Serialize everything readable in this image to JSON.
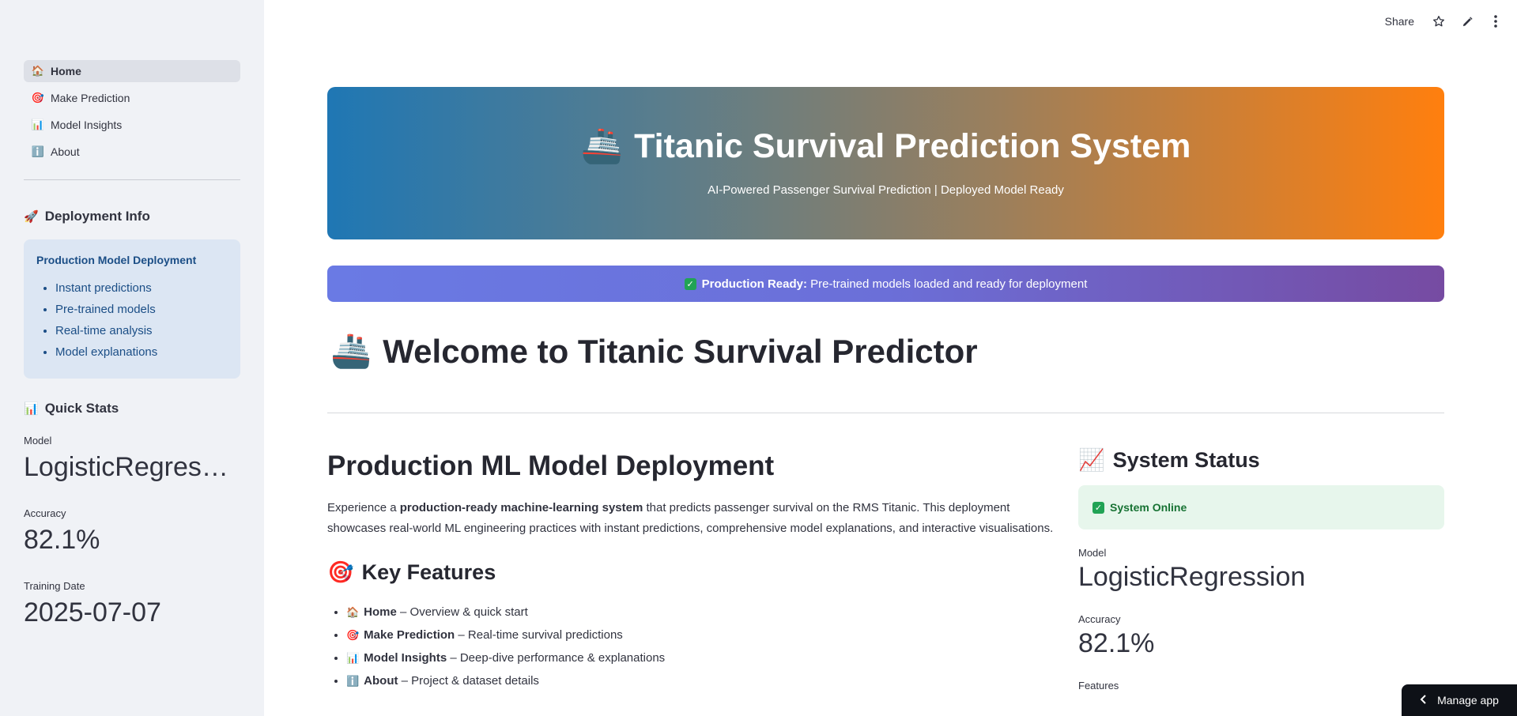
{
  "sidebar": {
    "nav": [
      {
        "icon": "🏠",
        "label": "Home",
        "active": true
      },
      {
        "icon": "🎯",
        "label": "Make Prediction"
      },
      {
        "icon": "📊",
        "label": "Model Insights"
      },
      {
        "icon": "ℹ️",
        "label": "About"
      }
    ],
    "deployment_heading": "Deployment Info",
    "deployment_box": {
      "title": "Production Model Deployment",
      "items": [
        "Instant predictions",
        "Pre-trained models",
        "Real-time analysis",
        "Model explanations"
      ]
    },
    "stats_heading": "Quick Stats",
    "stats": {
      "model_label": "Model",
      "model_value": "LogisticRegress…",
      "accuracy_label": "Accuracy",
      "accuracy_value": "82.1%",
      "date_label": "Training Date",
      "date_value": "2025-07-07"
    }
  },
  "toolbar": {
    "share_label": "Share"
  },
  "hero": {
    "title": "Titanic Survival Prediction System",
    "subtitle": "AI-Powered Passenger Survival Prediction | Deployed Model Ready"
  },
  "banner": {
    "bold": "Production Ready:",
    "text": "Pre-trained models loaded and ready for deployment"
  },
  "welcome_title": "Welcome to Titanic Survival Predictor",
  "main": {
    "heading": "Production ML Model Deployment",
    "intro_prefix": "Experience a ",
    "intro_bold": "production-ready machine-learning system",
    "intro_rest": " that predicts passenger survival on the RMS Titanic. This deployment showcases real-world ML engineering practices with instant predictions, comprehensive model explanations, and interactive visualisations.",
    "features_heading": "Key Features",
    "features": [
      {
        "icon": "🏠",
        "name": "Home",
        "desc": " – Overview & quick start"
      },
      {
        "icon": "🎯",
        "name": "Make Prediction",
        "desc": " – Real-time survival predictions"
      },
      {
        "icon": "📊",
        "name": "Model Insights",
        "desc": " – Deep-dive performance & explanations"
      },
      {
        "icon": "ℹ️",
        "name": "About",
        "desc": " – Project & dataset details"
      }
    ]
  },
  "system_status": {
    "heading": "System Status",
    "status": "System Online",
    "model_label": "Model",
    "model_value": "LogisticRegression",
    "accuracy_label": "Accuracy",
    "accuracy_value": "82.1%",
    "features_label": "Features"
  },
  "manage_app": "Manage app",
  "colors": {
    "sidebar_bg": "#f0f2f6",
    "hero_start": "#1f77b4",
    "hero_end": "#ff7f0e",
    "banner_start": "#6a7ae4",
    "banner_end": "#764ba2",
    "success": "#21a355"
  }
}
